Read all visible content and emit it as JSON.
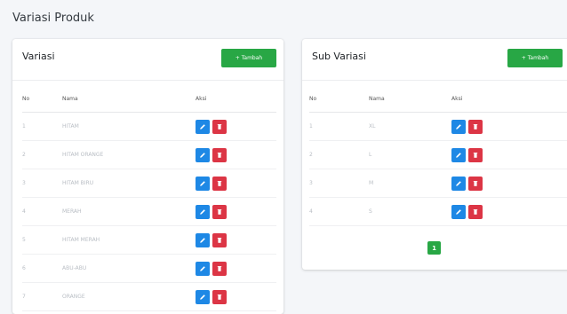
{
  "page": {
    "title": "Variasi Produk"
  },
  "colors": {
    "success": "#28a745",
    "edit": "#1e88e5",
    "delete": "#dc3545"
  },
  "variasi": {
    "title": "Variasi",
    "add_label": "+ Tambah",
    "headers": {
      "no": "No",
      "name": "Nama",
      "action": "Aksi"
    },
    "rows": [
      {
        "no": "1",
        "name": "HITAM"
      },
      {
        "no": "2",
        "name": "HITAM ORANGE"
      },
      {
        "no": "3",
        "name": "HITAM BIRU"
      },
      {
        "no": "4",
        "name": "MERAH"
      },
      {
        "no": "5",
        "name": "HITAM MERAH"
      },
      {
        "no": "6",
        "name": "ABU-ABU"
      },
      {
        "no": "7",
        "name": "ORANGE"
      }
    ]
  },
  "sub_variasi": {
    "title": "Sub Variasi",
    "add_label": "+ Tambah",
    "headers": {
      "no": "No",
      "name": "Nama",
      "action": "Aksi"
    },
    "rows": [
      {
        "no": "1",
        "name": "XL"
      },
      {
        "no": "2",
        "name": "L"
      },
      {
        "no": "3",
        "name": "M"
      },
      {
        "no": "4",
        "name": "S"
      }
    ],
    "pagination": {
      "current": "1"
    }
  }
}
